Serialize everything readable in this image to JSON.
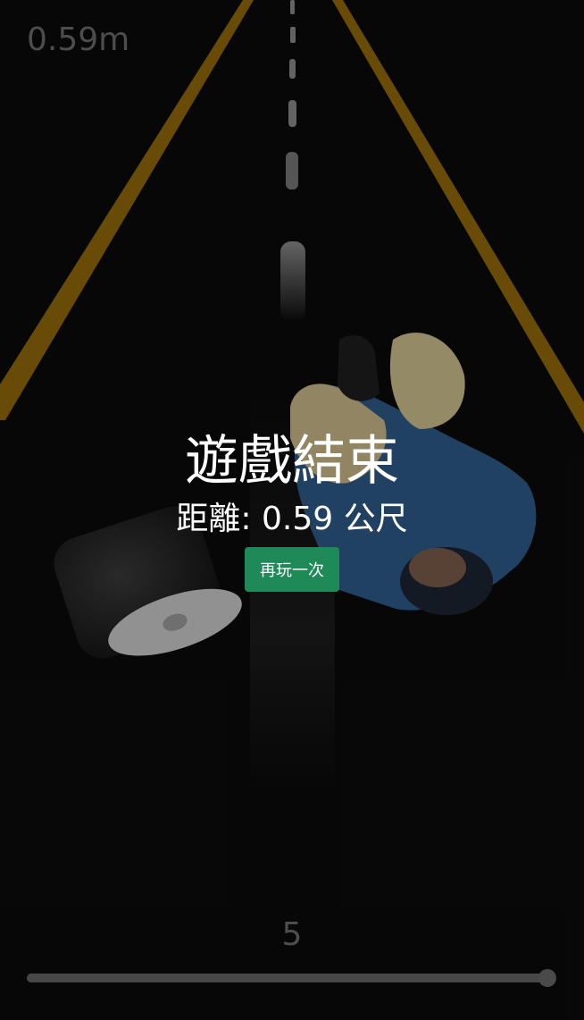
{
  "hud": {
    "distance_display": "0.59m"
  },
  "game_over": {
    "title": "遊戲結束",
    "distance_text": "距離: 0.59 公尺",
    "replay_label": "再玩一次"
  },
  "slider": {
    "value_label": "5",
    "fraction": 1.0
  },
  "colors": {
    "background": "#0b0b0b",
    "road_line": "#b8860b",
    "button": "#1e8a57",
    "hud_text": "#4d4d4d"
  },
  "scene": {
    "obstacle_1": "toilet-paper-roll-icon",
    "obstacle_2": "fallen-person-icon"
  }
}
